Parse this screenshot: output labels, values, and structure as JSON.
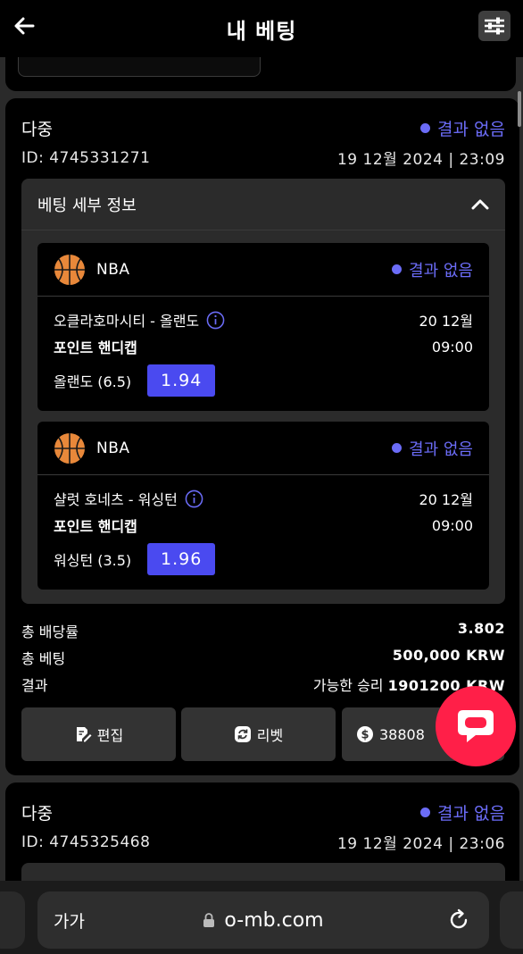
{
  "header": {
    "title": "내 베팅",
    "back_icon": "arrow-left-icon",
    "filter_icon": "sliders-icon"
  },
  "bets": [
    {
      "type": "다중",
      "status": "결과 없음",
      "id": "ID: 4745331271",
      "datetime": "19 12월 2024 | 23:09",
      "details_title": "베팅 세부 정보",
      "legs": [
        {
          "league": "NBA",
          "status": "결과 없음",
          "match": "오클라호마시티 - 올랜도",
          "date": "20 12월",
          "market": "포인트 핸디캡",
          "time": "09:00",
          "pick": "올랜도 (6.5)",
          "odds": "1.94"
        },
        {
          "league": "NBA",
          "status": "결과 없음",
          "match": "샬럿 호네츠 - 워싱턴",
          "date": "20 12월",
          "market": "포인트 핸디캡",
          "time": "09:00",
          "pick": "워싱턴 (3.5)",
          "odds": "1.96"
        }
      ],
      "summary": {
        "odds_label": "총 배당률",
        "odds_value": "3.802",
        "stake_label": "총 베팅",
        "stake_value": "500,000 KRW",
        "result_label": "결과",
        "result_prefix": "가능한 승리",
        "result_value": "1901200 KRW"
      },
      "actions": {
        "edit": "편집",
        "rebet": "리벳",
        "cashout": "38808"
      }
    },
    {
      "type": "다중",
      "status": "결과 없음",
      "id": "ID: 4745325468",
      "datetime": "19 12월 2024 | 23:06"
    }
  ],
  "browser": {
    "text_size": "가가",
    "url": "o-mb.com"
  },
  "colors": {
    "accent": "#6b6cf7",
    "odds_bg": "#4a4af0",
    "chat": "#ff1f48",
    "ball": "#e8883a"
  }
}
